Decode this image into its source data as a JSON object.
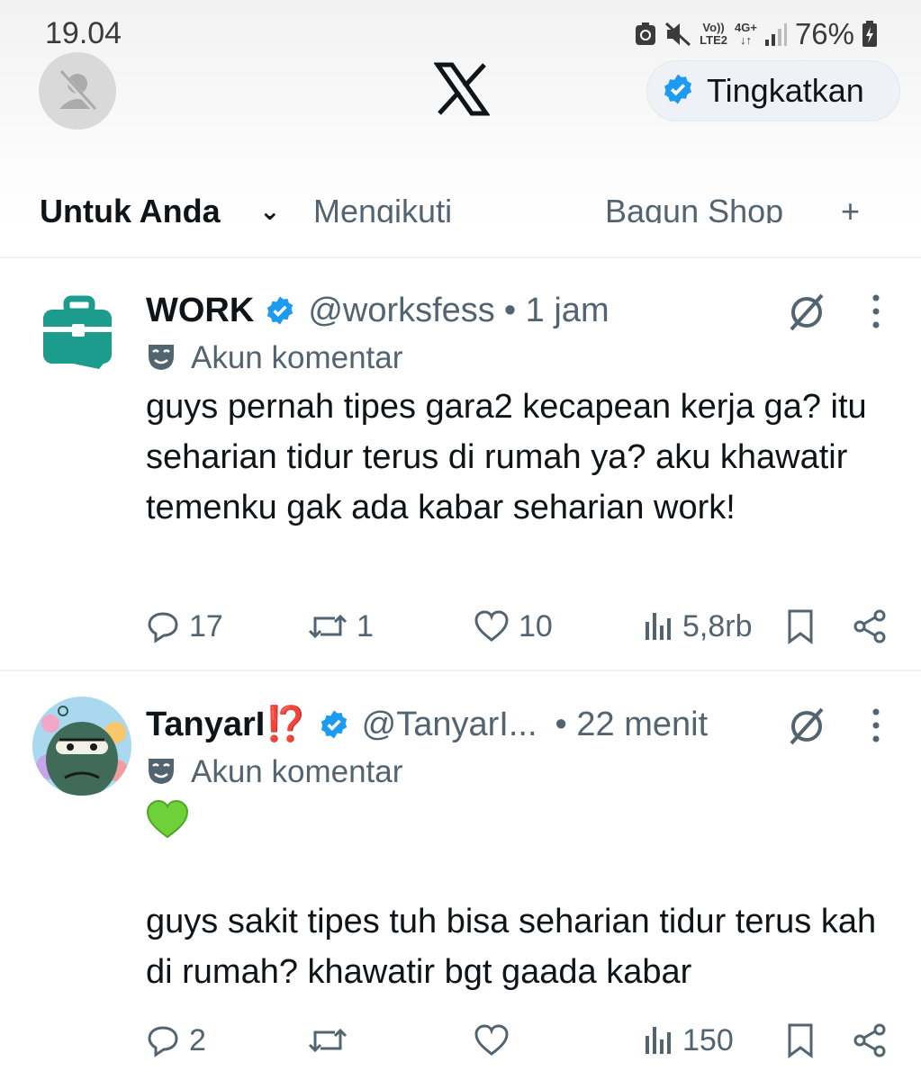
{
  "status_bar": {
    "time": "19.04",
    "vo_label": "Vo))",
    "lte_label": "LTE2",
    "net_label": "4G+",
    "battery": "76%"
  },
  "header": {
    "upgrade_label": "Tingkatkan",
    "tabs": [
      "Untuk Anda",
      "Mengikuti",
      "Bagun Shop"
    ]
  },
  "posts": [
    {
      "name": "WORK",
      "handle": "@worksfess",
      "time": "• 1 jam",
      "community_label": "Akun komentar",
      "body": "guys pernah tipes gara2 kecapean kerja ga? itu seharian tidur terus di rumah ya? aku khawatir temenku gak ada kabar seharian work!",
      "replies": "17",
      "reposts": "1",
      "likes": "10",
      "views": "5,8rb"
    },
    {
      "name": "TanyarI⁉️",
      "handle": "@TanyarI...",
      "time": "• 22 menit",
      "community_label": "Akun komentar",
      "emoji": "💚",
      "body": "guys sakit tipes tuh bisa seharian tidur terus kah di rumah? khawatir bgt gaada kabar",
      "replies": "2",
      "reposts": "",
      "likes": "",
      "views": "150"
    }
  ],
  "colors": {
    "verified_blue": "#1d9bf0",
    "text_secondary": "#536471",
    "work_teal": "#1b9c8c",
    "heart_green": "#6fd13a"
  }
}
